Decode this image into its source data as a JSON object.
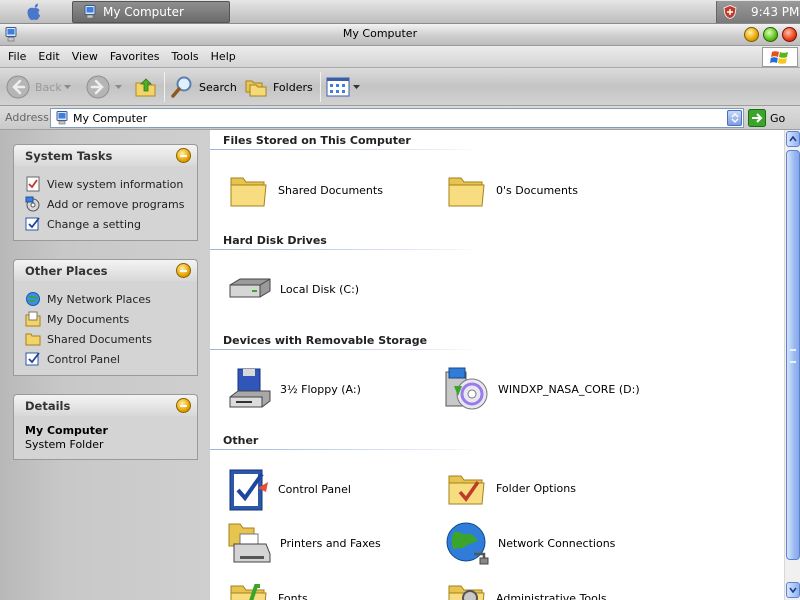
{
  "taskbar": {
    "start_icon": "apple-icon",
    "task_label": "My Computer",
    "clock": "9:43 PM"
  },
  "window": {
    "title": "My Computer"
  },
  "menu": {
    "items": [
      "File",
      "Edit",
      "View",
      "Favorites",
      "Tools",
      "Help"
    ]
  },
  "toolbar": {
    "back_label": "Back",
    "search_label": "Search",
    "folders_label": "Folders"
  },
  "address": {
    "label": "Address",
    "value": "My Computer",
    "go_label": "Go"
  },
  "sidebar": {
    "system_tasks": {
      "title": "System Tasks",
      "items": [
        "View system information",
        "Add or remove programs",
        "Change a setting"
      ]
    },
    "other_places": {
      "title": "Other Places",
      "items": [
        "My Network Places",
        "My Documents",
        "Shared Documents",
        "Control Panel"
      ]
    },
    "details": {
      "title": "Details",
      "name": "My Computer",
      "type": "System Folder"
    }
  },
  "content": {
    "groups": [
      {
        "title": "Files Stored on This Computer",
        "items": [
          "Shared Documents",
          "0's Documents"
        ]
      },
      {
        "title": "Hard Disk Drives",
        "items": [
          "Local Disk (C:)"
        ]
      },
      {
        "title": "Devices with Removable Storage",
        "items": [
          "3½ Floppy (A:)",
          "WINDXP_NASA_CORE (D:)"
        ]
      },
      {
        "title": "Other",
        "items": [
          "Control Panel",
          "Folder Options",
          "Printers and Faxes",
          "Network Connections",
          "Fonts",
          "Administrative Tools"
        ]
      }
    ]
  },
  "colors": {
    "address_border": "#7f9db9",
    "scroll_accent": "#5c82d0",
    "group_rule": "#9fb4d9"
  }
}
